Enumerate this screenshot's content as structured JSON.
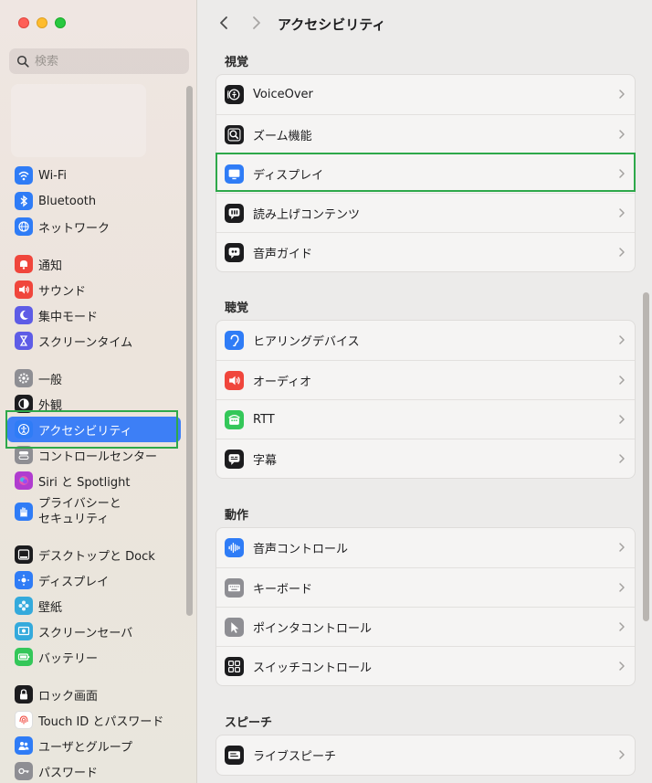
{
  "window": {
    "title": "アクセシビリティ"
  },
  "sidebar": {
    "search_placeholder": "検索",
    "groups": [
      [
        {
          "label": "Wi-Fi",
          "icon": "wifi-icon",
          "color": "#2f7cf6"
        },
        {
          "label": "Bluetooth",
          "icon": "bluetooth-icon",
          "color": "#2f7cf6"
        },
        {
          "label": "ネットワーク",
          "icon": "globe-icon",
          "color": "#2f7cf6"
        }
      ],
      [
        {
          "label": "通知",
          "icon": "bell-icon",
          "color": "#f0463c"
        },
        {
          "label": "サウンド",
          "icon": "speaker-icon",
          "color": "#f0463c"
        },
        {
          "label": "集中モード",
          "icon": "moon-icon",
          "color": "#5e5ce6"
        },
        {
          "label": "スクリーンタイム",
          "icon": "hourglass-icon",
          "color": "#5e5ce6"
        }
      ],
      [
        {
          "label": "一般",
          "icon": "gear-icon",
          "color": "#8e8e93"
        },
        {
          "label": "外観",
          "icon": "appearance-icon",
          "color": "#1c1c1e"
        },
        {
          "label": "アクセシビリティ",
          "icon": "accessibility-icon",
          "color": "#2f7cf6",
          "selected": true
        },
        {
          "label": "コントロールセンター",
          "icon": "toggles-icon",
          "color": "#8e8e93"
        },
        {
          "label": "Siri と Spotlight",
          "icon": "siri-icon",
          "color": "#b03ccf"
        },
        {
          "label": "プライバシーと\nセキュリティ",
          "icon": "hand-icon",
          "color": "#2f7cf6",
          "two_line": true
        }
      ],
      [
        {
          "label": "デスクトップと Dock",
          "icon": "dock-icon",
          "color": "#1c1c1e"
        },
        {
          "label": "ディスプレイ",
          "icon": "sun-icon",
          "color": "#2f7cf6"
        },
        {
          "label": "壁紙",
          "icon": "flower-icon",
          "color": "#34aadc"
        },
        {
          "label": "スクリーンセーバ",
          "icon": "screensaver-icon",
          "color": "#34aadc"
        },
        {
          "label": "バッテリー",
          "icon": "battery-icon",
          "color": "#34c759"
        }
      ],
      [
        {
          "label": "ロック画面",
          "icon": "lock-icon",
          "color": "#1c1c1e"
        },
        {
          "label": "Touch ID とパスワード",
          "icon": "fingerprint-icon",
          "color": "#ffffff"
        },
        {
          "label": "ユーザとグループ",
          "icon": "users-icon",
          "color": "#2f7cf6"
        },
        {
          "label": "パスワード",
          "icon": "key-icon",
          "color": "#8e8e93"
        }
      ]
    ]
  },
  "main": {
    "sections": [
      {
        "title": "視覚",
        "rows": [
          {
            "label": "VoiceOver",
            "icon": "voiceover-icon",
            "color": "#1c1c1e"
          },
          {
            "label": "ズーム機能",
            "icon": "zoom-icon",
            "color": "#1c1c1e"
          },
          {
            "label": "ディスプレイ",
            "icon": "display-icon",
            "color": "#2f7cf6"
          },
          {
            "label": "読み上げコンテンツ",
            "icon": "speech-bubble-icon",
            "color": "#1c1c1e"
          },
          {
            "label": "音声ガイド",
            "icon": "quote-bubble-icon",
            "color": "#1c1c1e"
          }
        ]
      },
      {
        "title": "聴覚",
        "rows": [
          {
            "label": "ヒアリングデバイス",
            "icon": "ear-icon",
            "color": "#2f7cf6"
          },
          {
            "label": "オーディオ",
            "icon": "speaker-icon",
            "color": "#f0463c"
          },
          {
            "label": "RTT",
            "icon": "rtt-icon",
            "color": "#34c759"
          },
          {
            "label": "字幕",
            "icon": "caption-icon",
            "color": "#1c1c1e"
          }
        ]
      },
      {
        "title": "動作",
        "rows": [
          {
            "label": "音声コントロール",
            "icon": "waveform-icon",
            "color": "#2f7cf6"
          },
          {
            "label": "キーボード",
            "icon": "keyboard-icon",
            "color": "#8e8e93"
          },
          {
            "label": "ポインタコントロール",
            "icon": "pointer-icon",
            "color": "#8e8e93"
          },
          {
            "label": "スイッチコントロール",
            "icon": "switch-grid-icon",
            "color": "#1c1c1e"
          }
        ]
      },
      {
        "title": "スピーチ",
        "rows": [
          {
            "label": "ライブスピーチ",
            "icon": "live-speech-icon",
            "color": "#1c1c1e"
          }
        ]
      }
    ]
  }
}
